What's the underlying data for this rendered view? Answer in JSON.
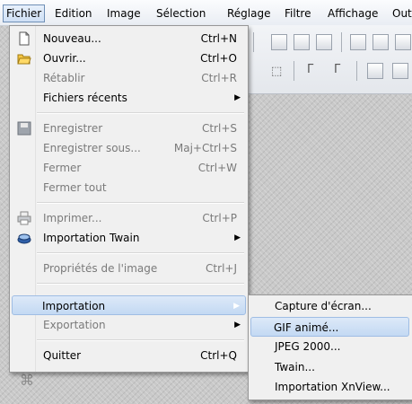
{
  "menubar": {
    "items": [
      "Fichier",
      "Edition",
      "Image",
      "Sélection",
      "Réglage",
      "Filtre",
      "Affichage",
      "Out"
    ]
  },
  "file_menu": {
    "items": [
      {
        "label": "Nouveau...",
        "shortcut": "Ctrl+N",
        "icon": "new-document-icon",
        "disabled": false
      },
      {
        "label": "Ouvrir...",
        "shortcut": "Ctrl+O",
        "icon": "open-folder-icon",
        "disabled": false
      },
      {
        "label": "Rétablir",
        "shortcut": "Ctrl+R",
        "icon": "",
        "disabled": true
      },
      {
        "label": "Fichiers récents",
        "shortcut": "",
        "icon": "",
        "disabled": false,
        "submenu": true
      },
      {
        "label": "Enregistrer",
        "shortcut": "Ctrl+S",
        "icon": "save-icon",
        "disabled": true
      },
      {
        "label": "Enregistrer sous...",
        "shortcut": "Maj+Ctrl+S",
        "icon": "",
        "disabled": true
      },
      {
        "label": "Fermer",
        "shortcut": "Ctrl+W",
        "icon": "",
        "disabled": true
      },
      {
        "label": "Fermer tout",
        "shortcut": "",
        "icon": "",
        "disabled": true
      },
      {
        "label": "Imprimer...",
        "shortcut": "Ctrl+P",
        "icon": "printer-icon",
        "disabled": true
      },
      {
        "label": "Importation Twain",
        "shortcut": "",
        "icon": "scanner-icon",
        "disabled": false,
        "submenu": true
      },
      {
        "label": "Propriétés de l'image",
        "shortcut": "Ctrl+J",
        "icon": "",
        "disabled": true
      },
      {
        "label": "Importation",
        "shortcut": "",
        "icon": "",
        "disabled": false,
        "submenu": true,
        "highlighted": true
      },
      {
        "label": "Exportation",
        "shortcut": "",
        "icon": "",
        "disabled": true,
        "submenu": true
      },
      {
        "label": "Quitter",
        "shortcut": "Ctrl+Q",
        "icon": "",
        "disabled": false
      }
    ]
  },
  "import_submenu": {
    "items": [
      {
        "label": "Capture d'écran...",
        "highlighted": false
      },
      {
        "label": "GIF animé...",
        "highlighted": true
      },
      {
        "label": "JPEG 2000...",
        "highlighted": false
      },
      {
        "label": "Twain...",
        "highlighted": false
      },
      {
        "label": "Importation XnView...",
        "highlighted": false
      }
    ]
  }
}
